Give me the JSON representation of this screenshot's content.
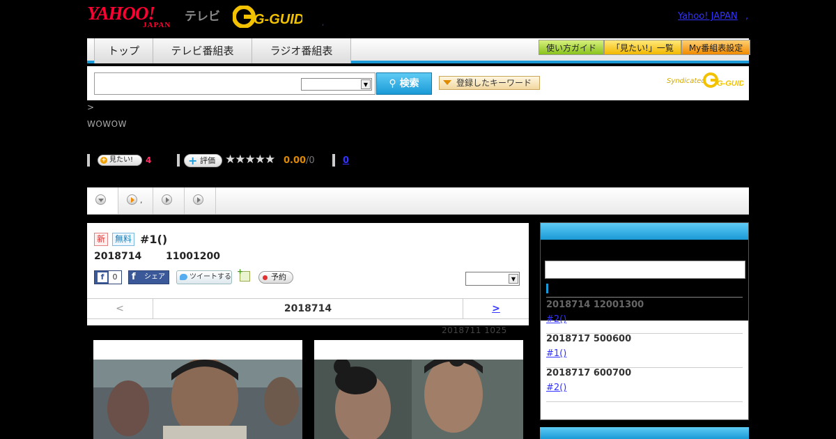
{
  "header": {
    "yahoo_logo_top": "YAHOO!",
    "yahoo_logo_bottom": "JAPAN",
    "tv_label": "テレビ",
    "gguide_logo": "G-GUIDE",
    "dot_left": ",",
    "yahoo_japan_link": "Yahoo! JAPAN",
    "dot_right": ","
  },
  "nav": {
    "tabs": [
      "トップ",
      "テレビ番組表",
      "ラジオ番組表"
    ],
    "buttons": [
      "使い方ガイド",
      "「見たい!」一覧",
      "My番組表設定"
    ]
  },
  "search": {
    "value": "",
    "select_value": "",
    "button_label": "検索",
    "keyword_button": "登録したキーワード",
    "syndicated": "Syndicated",
    "syndicated_logo": "G-GUIDE"
  },
  "breadcrumb": ">",
  "channel": "WOWOW",
  "stats": {
    "want_label": "見たい!",
    "want_count": "4",
    "rate_label": "評価",
    "stars": "★★★★★",
    "score": "0.00",
    "score_count": "/0",
    "review_count": "0"
  },
  "subtabs": {
    "dot": ","
  },
  "program": {
    "badge_new": "新",
    "badge_free": "無料",
    "title": "#1()",
    "date": "2018714",
    "time": "11001200",
    "fb_like_f": "f",
    "fb_like_count": "0",
    "fb_share": "シェア",
    "fb_share_f": "f",
    "tweet": "ツイートする",
    "reserve": "予約",
    "nav_prev": "<",
    "nav_current": "2018714",
    "nav_next": ">",
    "updated": "2018711  1025"
  },
  "sidebar": {
    "items": [
      {
        "when": "2018714  12001300",
        "episode": "#2()"
      },
      {
        "when": "2018717  500600",
        "episode": "#1()"
      },
      {
        "when": "2018717  600700",
        "episode": "#2()"
      }
    ]
  },
  "colors": {
    "accent_blue": "#1a9ad6",
    "link": "#3333ff",
    "yahoo_red": "#ff0033",
    "gguide_yellow": "#f2c200",
    "score_orange": "#e08a00"
  },
  "icons": [
    "search-icon",
    "play-icon",
    "dropdown-arrow-icon",
    "facebook-icon",
    "twitter-bird-icon",
    "calendar-add-icon",
    "record-dot-icon",
    "star-icon"
  ]
}
